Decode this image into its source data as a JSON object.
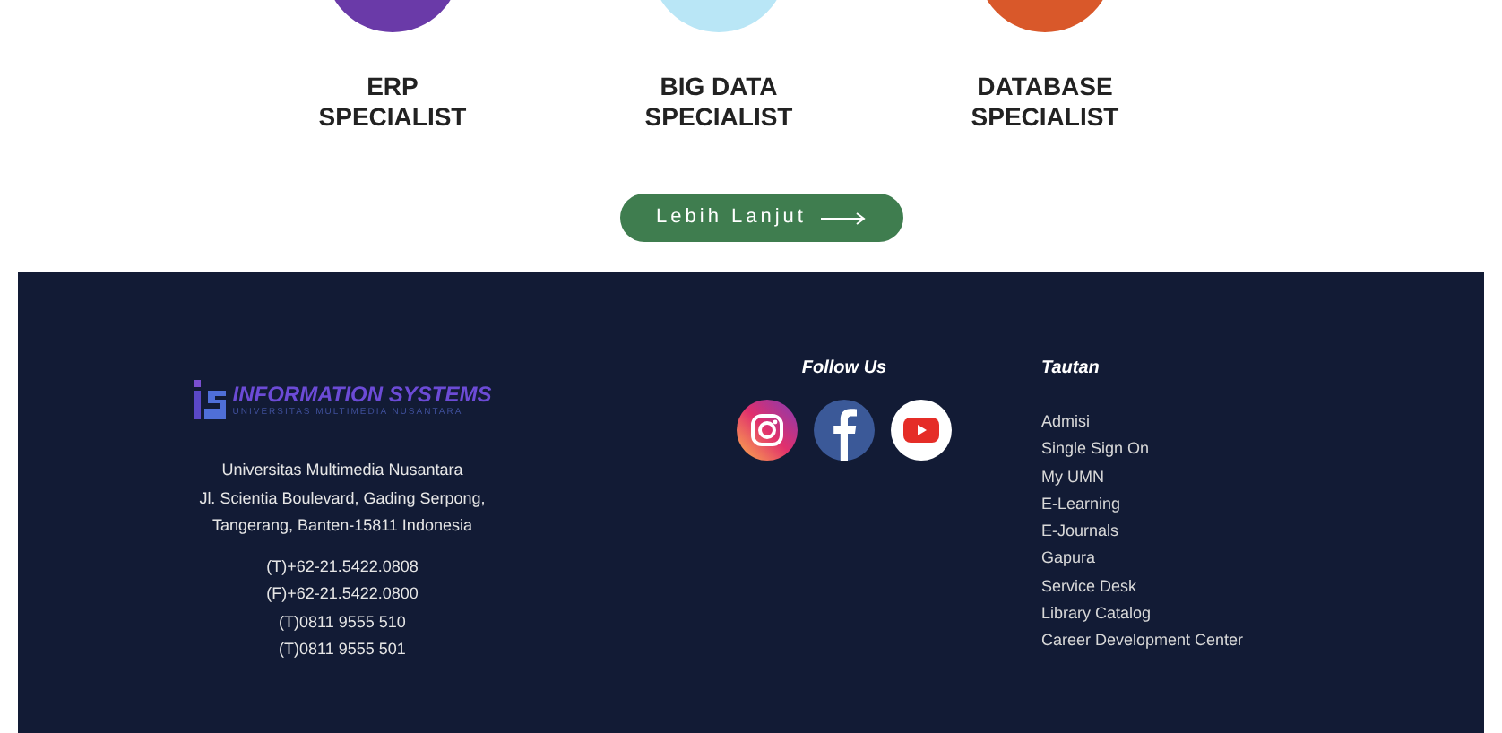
{
  "roles": [
    {
      "title": "ERP SPECIALIST",
      "color": "#6a3aa8"
    },
    {
      "title": "BIG DATA SPECIALIST",
      "color": "#b9e6f6"
    },
    {
      "title": "DATABASE SPECIALIST",
      "color": "#d9582a"
    }
  ],
  "more_button": {
    "label": "Lebih Lanjut"
  },
  "footer": {
    "logo": {
      "name": "INFORMATION SYSTEMS",
      "subtitle": "UNIVERSITAS MULTIMEDIA NUSANTARA"
    },
    "address": [
      "Universitas Multimedia Nusantara",
      "Jl. Scientia Boulevard, Gading Serpong,",
      "Tangerang, Banten-15811 Indonesia"
    ],
    "phones": [
      "(T)+62-21.5422.0808",
      "(F)+62-21.5422.0800",
      "(T)0811 9555 510",
      "(T)0811 9555 501"
    ],
    "follow": {
      "title": "Follow Us",
      "socials": [
        {
          "kind": "instagram"
        },
        {
          "kind": "facebook"
        },
        {
          "kind": "youtube"
        }
      ]
    },
    "links": {
      "title": "Tautan",
      "items": [
        "Admisi",
        "Single Sign On",
        "My UMN",
        "E-Learning",
        "E-Journals",
        "Gapura",
        "Service Desk",
        "Library Catalog",
        "Career Development Center"
      ]
    }
  }
}
